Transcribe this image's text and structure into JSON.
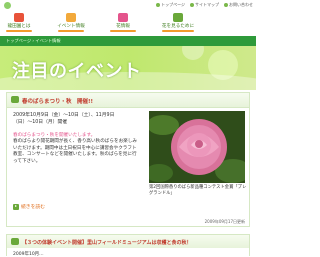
{
  "header": {
    "links": [
      {
        "label": "トップページ",
        "icon": "home-icon"
      },
      {
        "label": "サイトマップ",
        "icon": "sitemap-icon"
      },
      {
        "label": "お問い合わせ",
        "icon": "mail-icon"
      }
    ]
  },
  "nav": {
    "items": [
      {
        "label": "龍田園とは",
        "icon": "tree-icon",
        "icon_color": "#e8533a"
      },
      {
        "label": "イベント情報",
        "icon": "event-icon",
        "icon_color": "#f2a93b"
      },
      {
        "label": "花情報",
        "icon": "flower-icon",
        "icon_color": "#e4548c"
      },
      {
        "label": "花を見るために",
        "icon": "map-icon",
        "icon_color": "#6aa83a"
      }
    ]
  },
  "breadcrumb": "トップページ › イベント情報",
  "page": {
    "title": "注目のイベント"
  },
  "article1": {
    "title": "春のばらまつり・秋　開催!!",
    "date_line1": "2009年10月9日（金）〜10日（土）、11月9日",
    "date_line2": "（日）〜10日（月）開催",
    "highlight": "春のばらまつり・秋を開催いたします。",
    "body": "春のばらより開花期間が長く、香り高い秋のばらをお楽しみいただけます。期間中は土日祝日を中心に講習会やクラフト教室、コンサートなどを開催いたします。秋のばらを見に行って下さい。",
    "photo_caption": "第2回国際香りのばら新品種コンテスト金賞「プレグランドル」",
    "more_label": "続きを読む",
    "posted": "2009年09月17日更新"
  },
  "article2": {
    "title": "【３つの体験イベント開催】里山フィールドミュージアムは収穫と食の秋！",
    "text": "2009年10月…"
  },
  "colors": {
    "accent_green": "#2e9a3a",
    "hero_green": "#c7ec7a",
    "title_red": "#c0392b",
    "link_orange": "#e06d1a",
    "nav_underline": "#f29b2d"
  }
}
